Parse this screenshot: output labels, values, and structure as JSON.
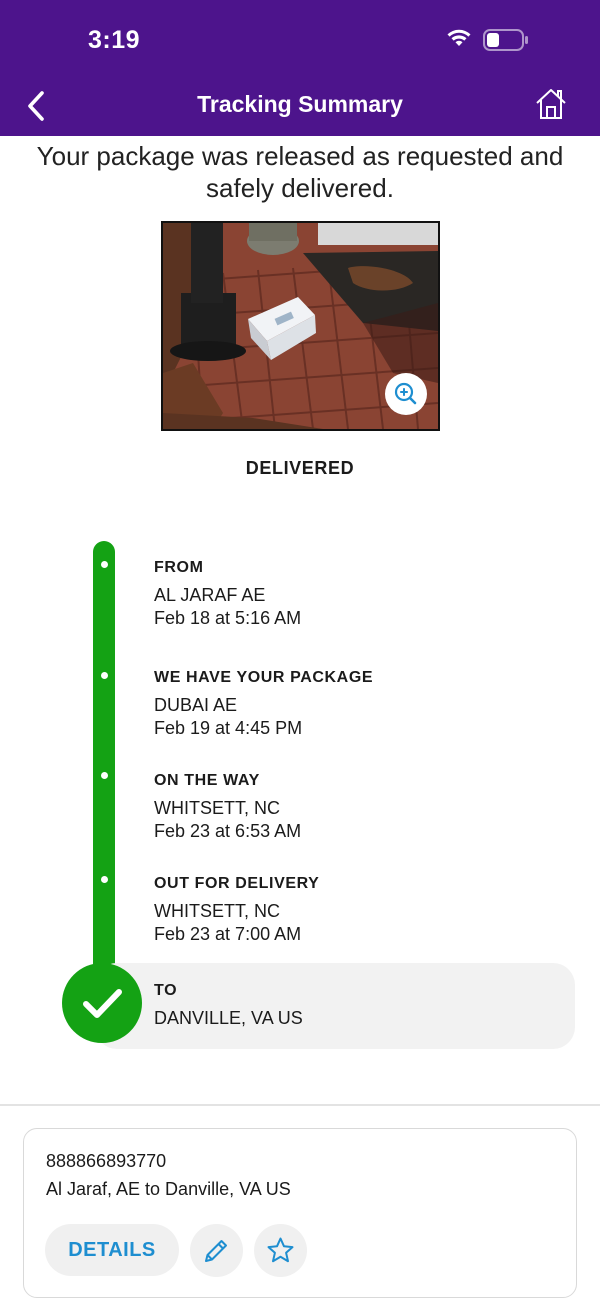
{
  "status_bar": {
    "time": "3:19",
    "battery_icon": "battery-low-icon",
    "wifi_icon": "wifi-icon"
  },
  "nav": {
    "title": "Tracking Summary",
    "back_icon": "chevron-left-icon",
    "home_icon": "home-icon"
  },
  "headline": "Your package was released as requested and safely delivered.",
  "photo": {
    "zoom_icon": "zoom-in-icon"
  },
  "delivery_status": "DELIVERED",
  "colors": {
    "brand_purple": "#4d148c",
    "progress_green": "#14a214",
    "link_blue": "#1e8ed0"
  },
  "timeline": [
    {
      "title": "FROM",
      "location": "AL JARAF AE",
      "time": "Feb 18 at 5:16 AM"
    },
    {
      "title": "WE HAVE YOUR PACKAGE",
      "location": "DUBAI AE",
      "time": "Feb 19 at 4:45 PM"
    },
    {
      "title": "ON THE WAY",
      "location": "WHITSETT, NC",
      "time": "Feb 23 at 6:53 AM"
    },
    {
      "title": "OUT FOR DELIVERY",
      "location": "WHITSETT, NC",
      "time": "Feb 23 at 7:00 AM"
    },
    {
      "title": "TO",
      "location": "DANVILLE, VA  US"
    }
  ],
  "card": {
    "tracking_number": "888866893770",
    "route": "Al Jaraf, AE to Danville, VA US",
    "details_label": "DETAILS",
    "edit_icon": "pencil-icon",
    "star_icon": "star-icon"
  }
}
